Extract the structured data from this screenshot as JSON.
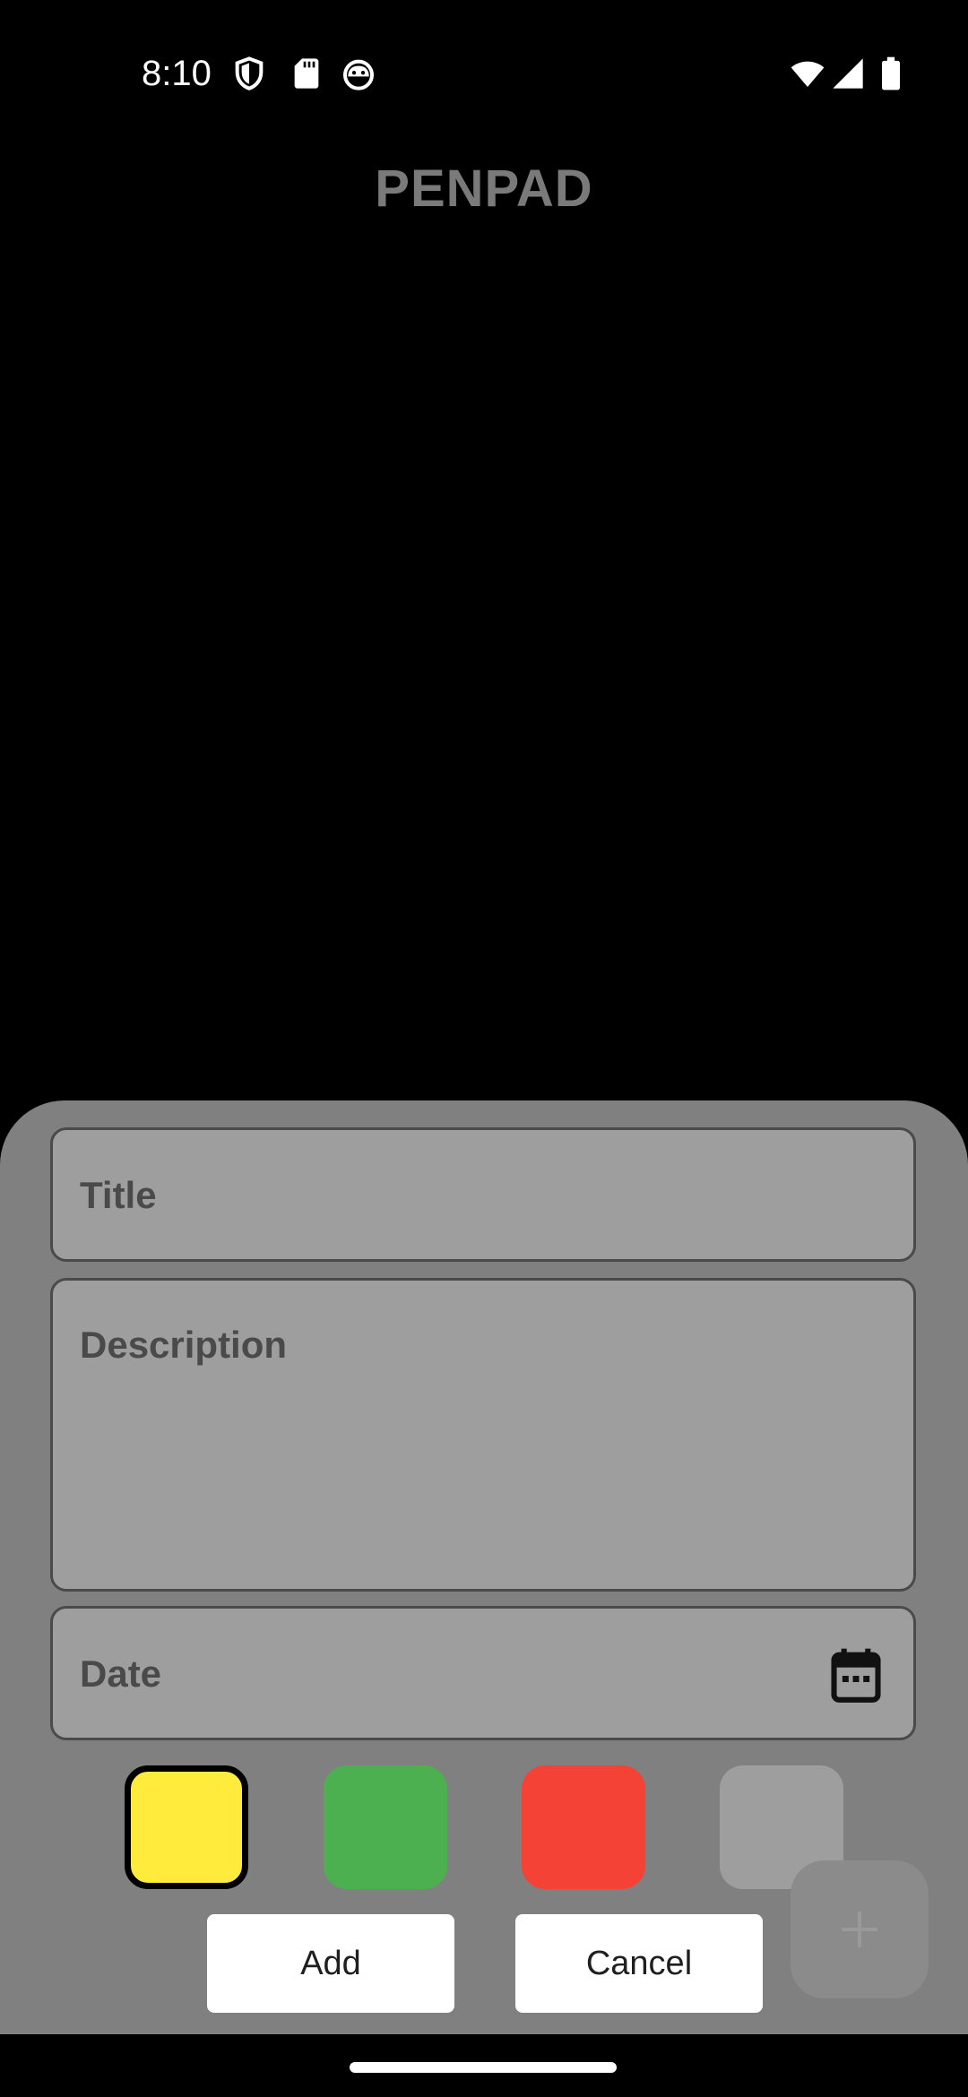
{
  "status_bar": {
    "time": "8:10",
    "left_icons": [
      "shield-icon",
      "sd-card-icon",
      "android-face-icon"
    ],
    "right_icons": [
      "wifi-icon",
      "cell-signal-icon",
      "battery-icon"
    ]
  },
  "app": {
    "title": "PENPAD"
  },
  "sheet": {
    "title_field": {
      "placeholder": "Title",
      "value": ""
    },
    "description_field": {
      "placeholder": "Description",
      "value": ""
    },
    "date_field": {
      "placeholder": "Date",
      "value": "",
      "icon": "calendar-icon"
    },
    "colors": [
      {
        "name": "yellow",
        "hex": "#ffeb3b",
        "selected": true
      },
      {
        "name": "green",
        "hex": "#4caf50",
        "selected": false
      },
      {
        "name": "red",
        "hex": "#f44336",
        "selected": false
      },
      {
        "name": "grey",
        "hex": "#9e9e9e",
        "selected": false
      }
    ],
    "add_label": "Add",
    "cancel_label": "Cancel"
  },
  "fab": {
    "icon": "plus-icon"
  }
}
